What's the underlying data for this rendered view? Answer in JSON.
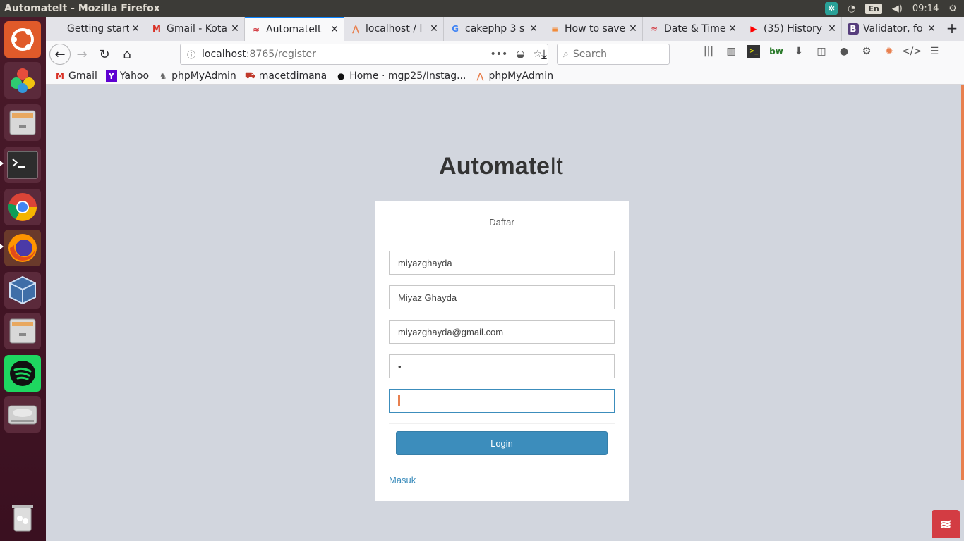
{
  "os": {
    "window_title": "AutomateIt - Mozilla Firefox",
    "keyboard_lang": "En",
    "clock": "09:14"
  },
  "launcher": {
    "items": [
      "ubuntu-dash",
      "solitaire",
      "files",
      "terminal",
      "chrome",
      "firefox",
      "virtualbox",
      "files-2",
      "spotify",
      "disk",
      "trash"
    ]
  },
  "tabs": [
    {
      "label": "Getting started",
      "icon": "cake-icon"
    },
    {
      "label": "Gmail - Kota",
      "icon": "gmail-icon"
    },
    {
      "label": "AutomateIt",
      "icon": "cake-icon",
      "active": true
    },
    {
      "label": "localhost / l",
      "icon": "phpmyadmin-icon"
    },
    {
      "label": "cakephp 3 s",
      "icon": "google-icon"
    },
    {
      "label": "How to save",
      "icon": "stackoverflow-icon"
    },
    {
      "label": "Date & Time",
      "icon": "cake-icon"
    },
    {
      "label": "(35) History",
      "icon": "youtube-icon"
    },
    {
      "label": "Validator, fo",
      "icon": "bootstrap-icon"
    }
  ],
  "url": {
    "host": "localhost",
    "path": ":8765/register"
  },
  "search": {
    "placeholder": "Search"
  },
  "bookmarks": [
    {
      "label": "Gmail"
    },
    {
      "label": "Yahoo"
    },
    {
      "label": "phpMyAdmin"
    },
    {
      "label": "macetdimana"
    },
    {
      "label": "Home · mgp25/Instag..."
    },
    {
      "label": "phpMyAdmin"
    }
  ],
  "page": {
    "logo_bold": "Automate",
    "logo_light": "It",
    "card_title": "Daftar",
    "fields": {
      "username": "miyazghayda",
      "fullname": "Miyaz Ghayda",
      "email": "miyazghayda@gmail.com",
      "password": "•"
    },
    "login_button": "Login",
    "masuk_link": "Masuk"
  }
}
